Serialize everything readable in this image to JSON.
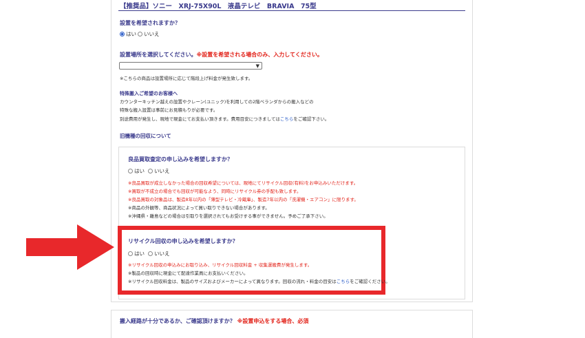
{
  "product_title": "【推奨品】ソニー　XRJ-75X90L　液晶テレビ　BRAVIA　75型",
  "install_question": {
    "heading": "設置を希望されますか？",
    "options": [
      "はい",
      "いいえ"
    ],
    "selected": "はい"
  },
  "location_question": {
    "heading": "設置場所を選択してください。",
    "heading_note": "※設置を希望される場合のみ、入力してください。",
    "select_value": "",
    "note": "※こちらの商品は設置場所に応じて階段上げ料金が発生致します。"
  },
  "special_delivery": {
    "heading": "特殊搬入ご希望のお客様へ",
    "lines": [
      "カウンターキッチン越えの設置やクレーン(ユニック)を利用しての2階ベランダからの搬入などの",
      "特殊な搬入設置は事前にお見積もりが必要です。"
    ],
    "line3_pre": "別途費用が発生し、現地で現金にてお支払い頂きます。費用目安につきましては",
    "line3_link": "こちら",
    "line3_post": "をご確認下さい。"
  },
  "old_unit": {
    "heading": "旧機種の回収について",
    "buyback": {
      "heading": "良品買取査定の申し込みを希望しますか？",
      "options": [
        "はい",
        "いいえ"
      ],
      "red_notes": [
        "※良品買取が成立しなかった場合の回収希望については、現地にてリサイクル回収(有料)をお申込みいただけます。",
        "※買取が不成立の場合でも回収が可能なよう、同時にリサイクル券の手配も致します。",
        "※良品買取の対象品は、製造8年以内の「薄型テレビ・冷蔵庫」、製造7年以内の「洗濯機・エアコン」に限ります。"
      ],
      "black_notes": [
        "※商品の外観等、商品状況によって買い取りできない場合があります。",
        "※沖縄県・離島などの場合は引取りを選択されてもお受けする事ができません。予めご了承下さい。"
      ]
    },
    "recycle": {
      "heading": "リサイクル回収の申し込みを希望しますか？",
      "options": [
        "はい",
        "いいえ"
      ],
      "red_note": "※リサイクル回収の申込みにお取り込み、リサイクル回収料金 + 収集運搬費が発生します。",
      "note2": "※製品の回収時に現金にて配達作業員にお支払いください。",
      "note3_pre": "※リサイクル回収料金は、製品のサイズおよびメーカーによって異なります。回収の流れ・料金の目安は",
      "note3_link": "こちら",
      "note3_post": "をご確認ください。"
    }
  },
  "route_question": {
    "heading": "搬入経路が十分であるか、ご確認頂けますか？",
    "heading_note": "※設置申込をする場合、必須"
  },
  "colors": {
    "heading_blue": "#3a3a8c",
    "alert_red": "#e2231a",
    "highlight_red": "#e8282b",
    "link_blue": "#2a5cc8"
  }
}
